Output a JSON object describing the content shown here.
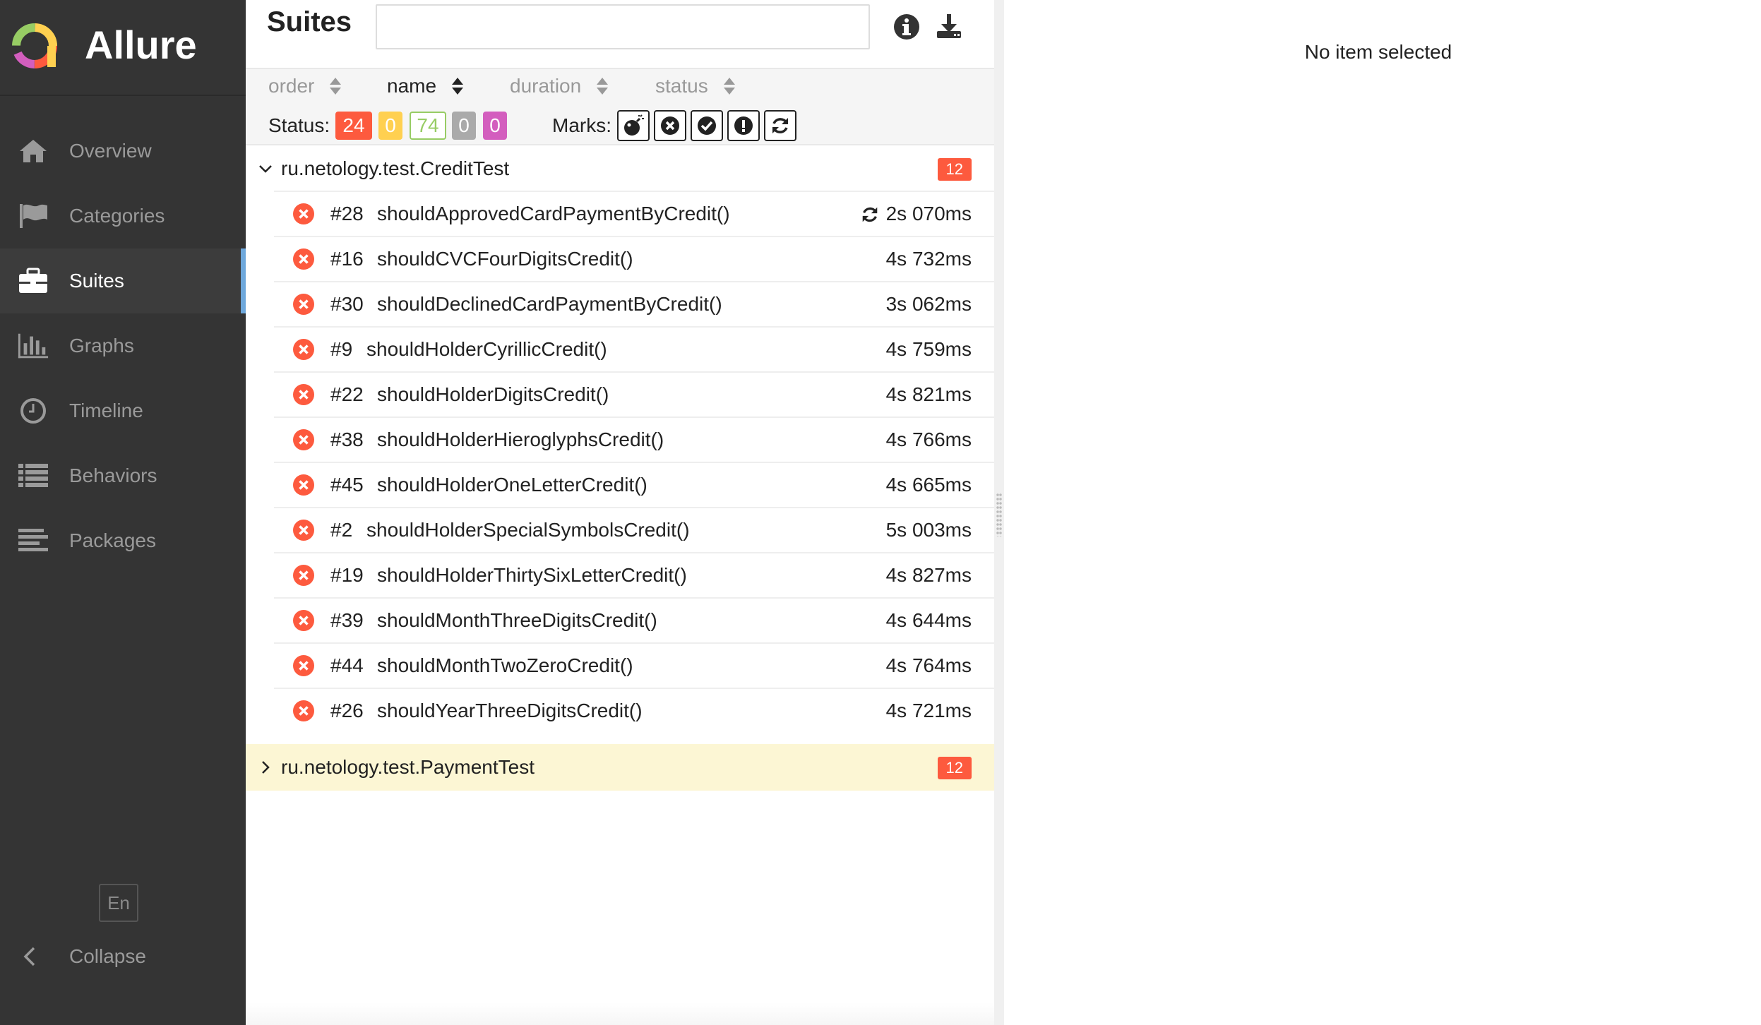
{
  "app": {
    "name": "Allure"
  },
  "sidebar": {
    "items": [
      {
        "label": "Overview",
        "icon": "home-icon",
        "active": false
      },
      {
        "label": "Categories",
        "icon": "flag-icon",
        "active": false
      },
      {
        "label": "Suites",
        "icon": "briefcase-icon",
        "active": true
      },
      {
        "label": "Graphs",
        "icon": "bar-chart-icon",
        "active": false
      },
      {
        "label": "Timeline",
        "icon": "clock-icon",
        "active": false
      },
      {
        "label": "Behaviors",
        "icon": "list-icon",
        "active": false
      },
      {
        "label": "Packages",
        "icon": "align-left-icon",
        "active": false
      }
    ],
    "language": "En",
    "collapse_label": "Collapse"
  },
  "suites": {
    "title": "Suites",
    "search": {
      "value": "",
      "placeholder": ""
    },
    "sort": [
      {
        "label": "order",
        "active": false
      },
      {
        "label": "name",
        "active": true
      },
      {
        "label": "duration",
        "active": false
      },
      {
        "label": "status",
        "active": false
      }
    ],
    "status_label": "Status:",
    "status_counts": [
      {
        "status": "failed",
        "count": "24",
        "color": "#fd5a3e"
      },
      {
        "status": "broken",
        "count": "0",
        "color": "#ffd050"
      },
      {
        "status": "passed",
        "count": "74",
        "color": "#97cc64"
      },
      {
        "status": "skipped",
        "count": "0",
        "color": "#aaaaaa"
      },
      {
        "status": "unknown",
        "count": "0",
        "color": "#d35ebe"
      }
    ],
    "marks_label": "Marks:",
    "marks": [
      "flaky-bomb-icon",
      "new-failed-icon",
      "new-passed-icon",
      "new-broken-icon",
      "retries-icon"
    ],
    "groups": [
      {
        "name": "ru.netology.test.CreditTest",
        "count": "12",
        "expanded": true,
        "tests": [
          {
            "num": "#28",
            "name": "shouldApprovedCardPaymentByCredit()",
            "duration": "2s 070ms",
            "retry": true
          },
          {
            "num": "#16",
            "name": "shouldCVCFourDigitsCredit()",
            "duration": "4s 732ms",
            "retry": false
          },
          {
            "num": "#30",
            "name": "shouldDeclinedCardPaymentByCredit()",
            "duration": "3s 062ms",
            "retry": false
          },
          {
            "num": "#9",
            "name": "shouldHolderCyrillicCredit()",
            "duration": "4s 759ms",
            "retry": false
          },
          {
            "num": "#22",
            "name": "shouldHolderDigitsCredit()",
            "duration": "4s 821ms",
            "retry": false
          },
          {
            "num": "#38",
            "name": "shouldHolderHieroglyphsCredit()",
            "duration": "4s 766ms",
            "retry": false
          },
          {
            "num": "#45",
            "name": "shouldHolderOneLetterCredit()",
            "duration": "4s 665ms",
            "retry": false
          },
          {
            "num": "#2",
            "name": "shouldHolderSpecialSymbolsCredit()",
            "duration": "5s 003ms",
            "retry": false
          },
          {
            "num": "#19",
            "name": "shouldHolderThirtySixLetterCredit()",
            "duration": "4s 827ms",
            "retry": false
          },
          {
            "num": "#39",
            "name": "shouldMonthThreeDigitsCredit()",
            "duration": "4s 644ms",
            "retry": false
          },
          {
            "num": "#44",
            "name": "shouldMonthTwoZeroCredit()",
            "duration": "4s 764ms",
            "retry": false
          },
          {
            "num": "#26",
            "name": "shouldYearThreeDigitsCredit()",
            "duration": "4s 721ms",
            "retry": false
          }
        ]
      },
      {
        "name": "ru.netology.test.PaymentTest",
        "count": "12",
        "expanded": false,
        "tests": []
      }
    ]
  },
  "detail": {
    "empty_text": "No item selected"
  }
}
